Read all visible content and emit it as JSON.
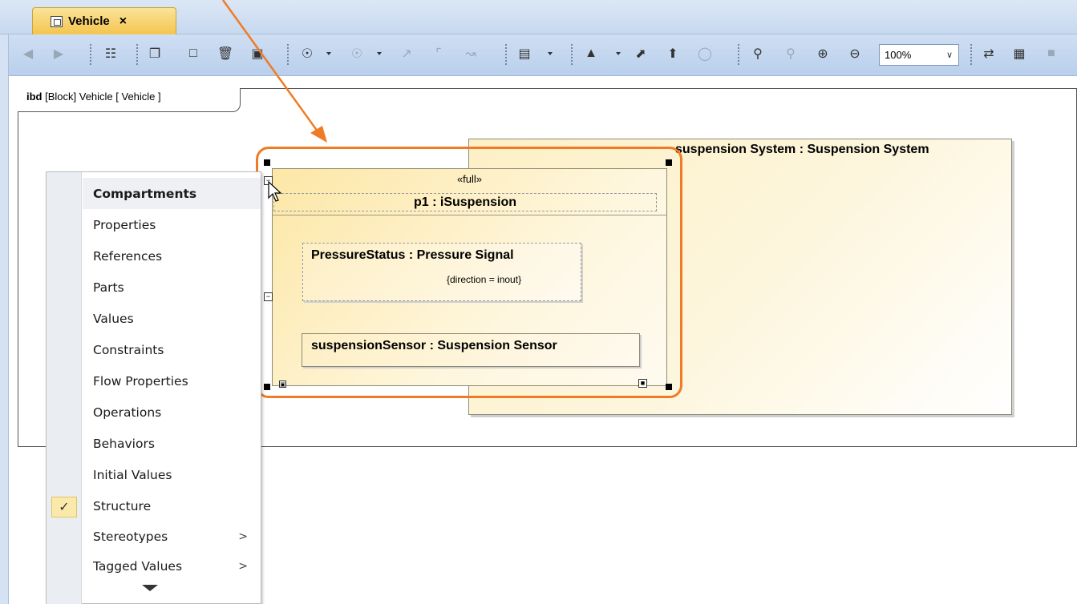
{
  "tab": {
    "title": "Vehicle",
    "close": "×"
  },
  "toolbar": {
    "zoom_value": "100%",
    "icons": [
      "back-icon",
      "forward-icon",
      "tree-icon",
      "copy-icon",
      "paste-icon",
      "delete-icon",
      "delete-from-model-icon",
      "layout-icon",
      "layout-options-icon",
      "path-straight-icon",
      "path-rectilinear-icon",
      "path-oblique-icon",
      "display-options-icon",
      "fill-color-icon",
      "sync-icon",
      "sync-up-icon",
      "auto-icon",
      "zoom-fit-icon",
      "zoom-selection-icon",
      "zoom-in-icon",
      "zoom-out-icon",
      "insert-icon",
      "grid-icon"
    ]
  },
  "diagram": {
    "label_kind": "ibd",
    "label_rest": " [Block] Vehicle [ Vehicle ]",
    "system_title": "suspension System : Suspension System",
    "port_stereotype": "«full»",
    "port_name": "p1 : iSuspension",
    "pressure_title": "PressureStatus : Pressure Signal",
    "pressure_direction": "{direction = inout}",
    "sensor_title": "suspensionSensor : Suspension Sensor",
    "highlight_color": "#f07b26"
  },
  "menu": {
    "header": "Compartments",
    "items": [
      {
        "label": "Properties"
      },
      {
        "label": "References"
      },
      {
        "label": "Parts"
      },
      {
        "label": "Values"
      },
      {
        "label": "Constraints"
      },
      {
        "label": "Flow Properties"
      },
      {
        "label": "Operations"
      },
      {
        "label": "Behaviors"
      },
      {
        "label": "Initial Values"
      },
      {
        "label": "Structure",
        "checked": true
      },
      {
        "label": "Stereotypes",
        "submenu": true
      },
      {
        "label": "Tagged Values",
        "submenu": true
      }
    ],
    "submenu_marker": ">",
    "check_mark": "✓"
  }
}
